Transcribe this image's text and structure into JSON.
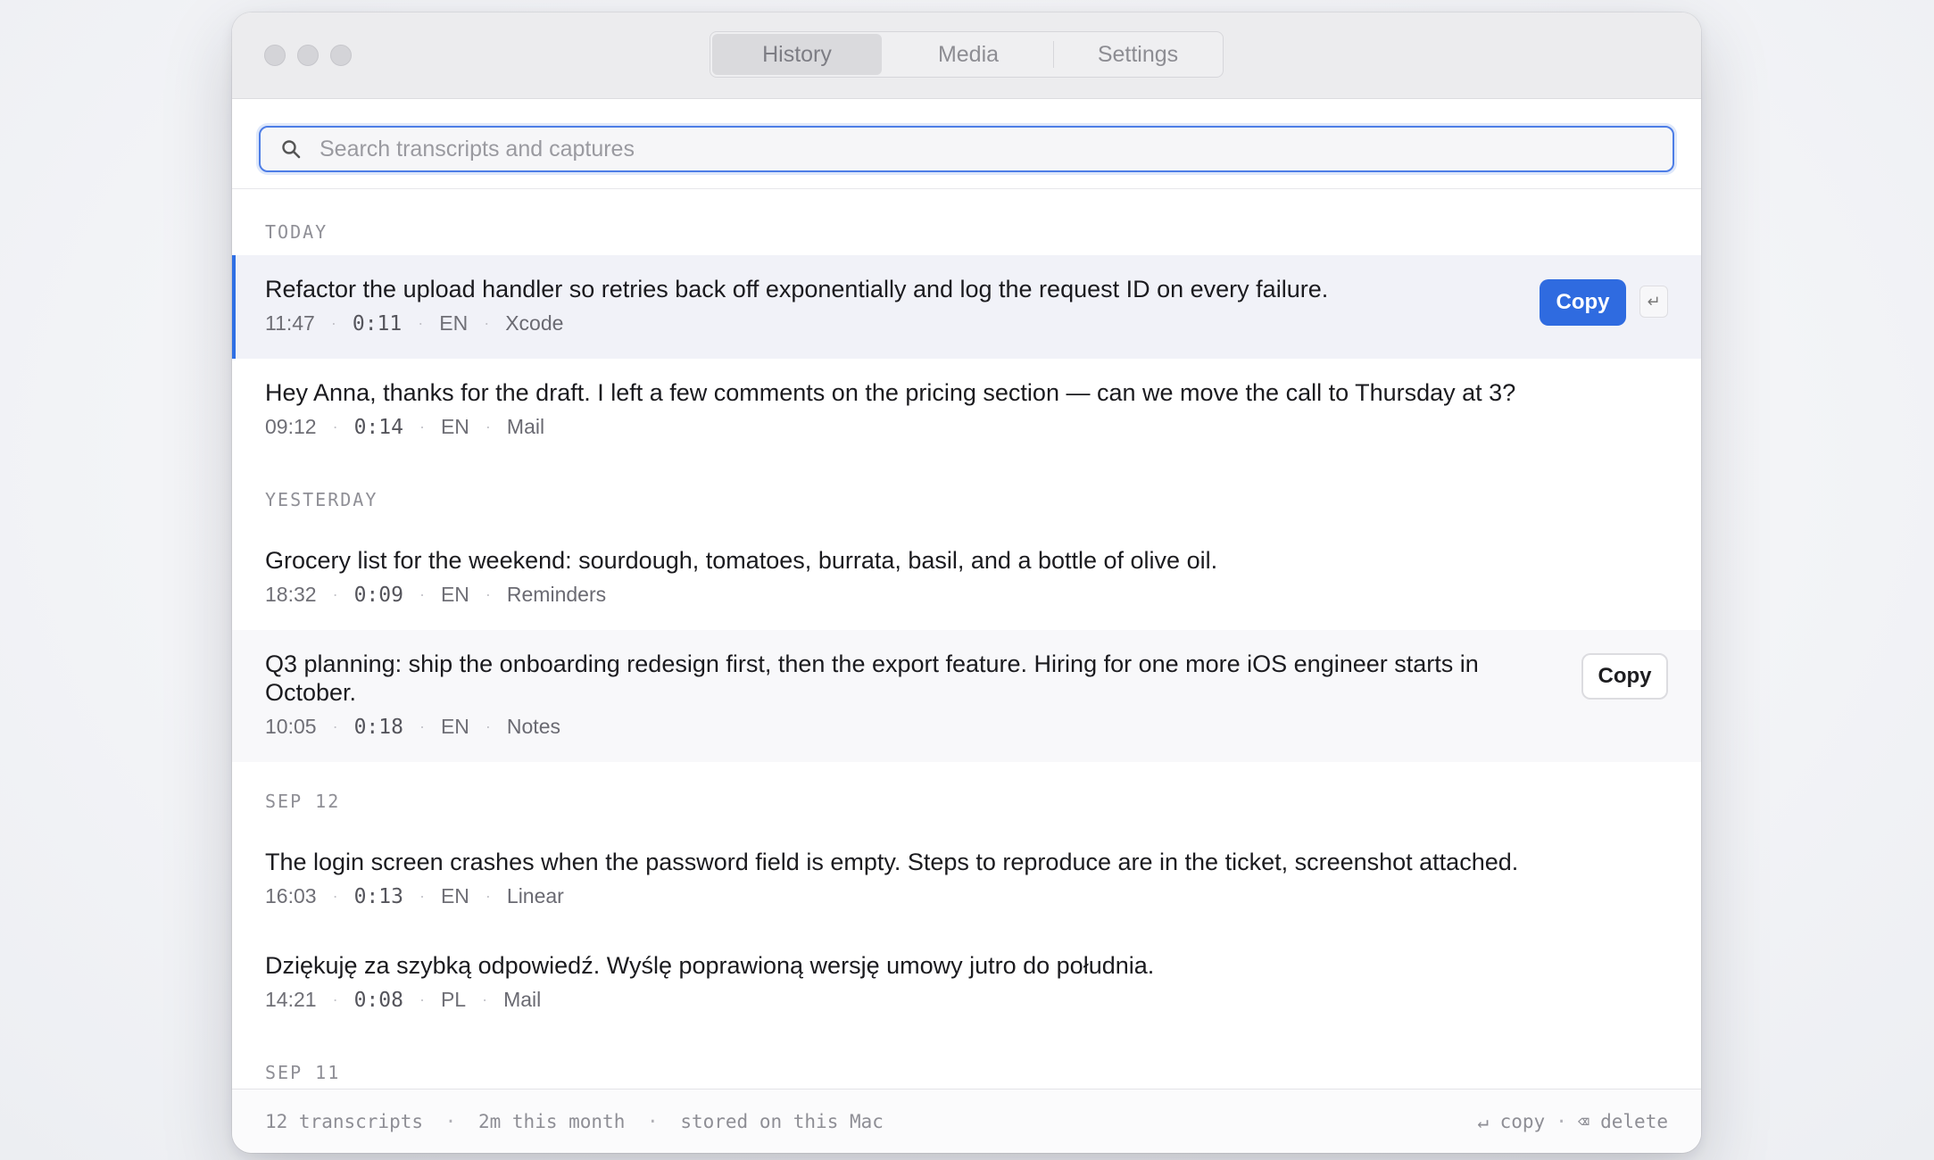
{
  "tabs": [
    {
      "label": "History",
      "active": true
    },
    {
      "label": "Media",
      "active": false
    },
    {
      "label": "Settings",
      "active": false
    }
  ],
  "search": {
    "placeholder": "Search transcripts and captures",
    "value": ""
  },
  "sections": [
    {
      "label": "TODAY",
      "items": [
        {
          "text": "Refactor the upload handler so retries back off exponentially and log the request ID on every failure.",
          "time": "11:47",
          "duration": "0:11",
          "lang": "EN",
          "app": "Xcode"
        },
        {
          "text": "Hey Anna, thanks for the draft. I left a few comments on the pricing section — can we move the call to Thursday at 3?",
          "time": "09:12",
          "duration": "0:14",
          "lang": "EN",
          "app": "Mail"
        }
      ]
    },
    {
      "label": "YESTERDAY",
      "items": [
        {
          "text": "Grocery list for the weekend: sourdough, tomatoes, burrata, basil, and a bottle of olive oil.",
          "time": "18:32",
          "duration": "0:09",
          "lang": "EN",
          "app": "Reminders"
        },
        {
          "text": "Q3 planning: ship the onboarding redesign first, then the export feature. Hiring for one more iOS engineer starts in October.",
          "time": "10:05",
          "duration": "0:18",
          "lang": "EN",
          "app": "Notes"
        }
      ]
    },
    {
      "label": "SEP 12",
      "items": [
        {
          "text": "The login screen crashes when the password field is empty. Steps to reproduce are in the ticket, screenshot attached.",
          "time": "16:03",
          "duration": "0:13",
          "lang": "EN",
          "app": "Linear"
        },
        {
          "text": "Dziękuję za szybką odpowiedź. Wyślę poprawioną wersję umowy jutro do południa.",
          "time": "14:21",
          "duration": "0:08",
          "lang": "PL",
          "app": "Mail"
        }
      ]
    },
    {
      "label": "SEP 11",
      "items": []
    }
  ],
  "actions": {
    "copy_label": "Copy",
    "return_glyph": "↵"
  },
  "footer": {
    "count": "12 transcripts",
    "usage": "2m this month",
    "storage": "stored on this Mac",
    "copy_hint": "↵ copy",
    "delete_hint": "⌫ delete",
    "separator": "·"
  },
  "colors": {
    "accent": "#2f6be0",
    "selected_row": "#f1f2f8",
    "focus_ring": "#4d7de6"
  }
}
